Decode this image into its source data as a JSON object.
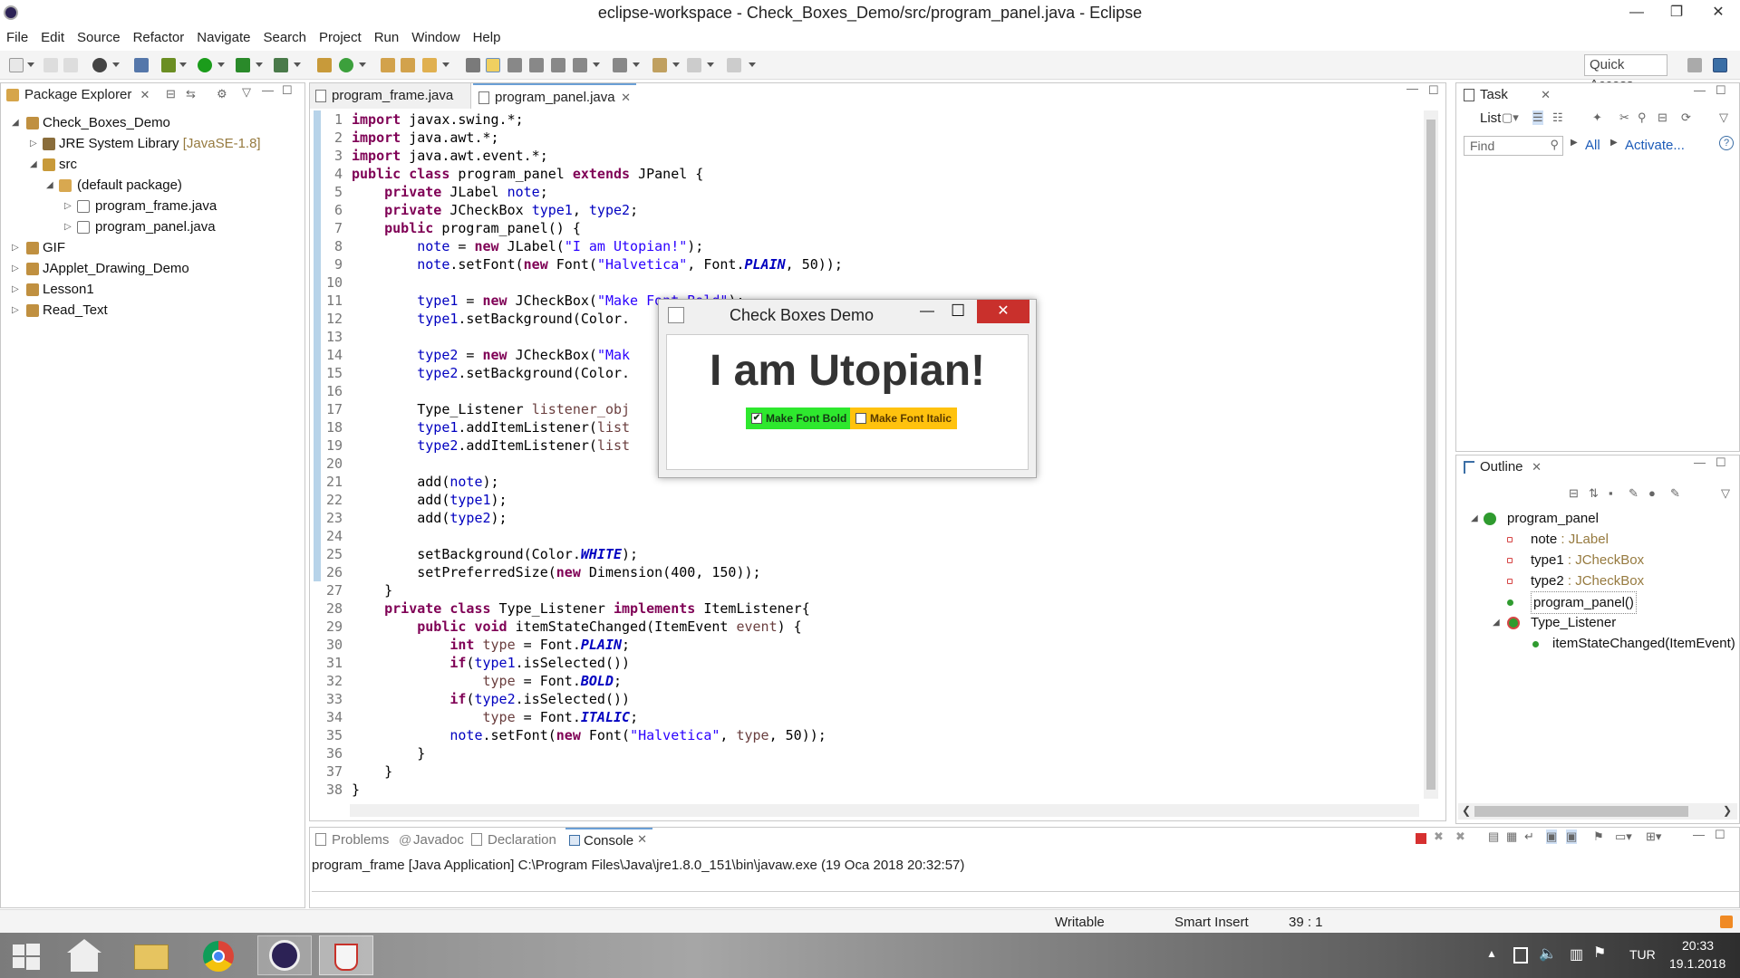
{
  "window": {
    "title": "eclipse-workspace - Check_Boxes_Demo/src/program_panel.java - Eclipse",
    "minimize": "—",
    "maximize": "❐",
    "close": "✕"
  },
  "menu": [
    "File",
    "Edit",
    "Source",
    "Refactor",
    "Navigate",
    "Search",
    "Project",
    "Run",
    "Window",
    "Help"
  ],
  "quick_access": "Quick Access",
  "package_explorer": {
    "title": "Package Explorer",
    "items": [
      {
        "label": "Check_Boxes_Demo",
        "depth": 0,
        "expanded": true
      },
      {
        "label": "JRE System Library",
        "decoration": "[JavaSE-1.8]",
        "depth": 1
      },
      {
        "label": "src",
        "depth": 1,
        "expanded": true
      },
      {
        "label": "(default package)",
        "depth": 2,
        "expanded": true
      },
      {
        "label": "program_frame.java",
        "depth": 3
      },
      {
        "label": "program_panel.java",
        "depth": 3
      },
      {
        "label": "GIF",
        "depth": 0
      },
      {
        "label": "JApplet_Drawing_Demo",
        "depth": 0
      },
      {
        "label": "Lesson1",
        "depth": 0
      },
      {
        "label": "Read_Text",
        "depth": 0
      }
    ]
  },
  "editor": {
    "tabs": [
      {
        "label": "program_frame.java",
        "active": false
      },
      {
        "label": "program_panel.java",
        "active": true
      }
    ],
    "lines": [
      "import javax.swing.*;",
      "import java.awt.*;",
      "import java.awt.event.*;",
      "public class program_panel extends JPanel {",
      "    private JLabel note;",
      "    private JCheckBox type1, type2;",
      "    public program_panel() {",
      "        note = new JLabel(\"I am Utopian!\");",
      "        note.setFont(new Font(\"Halvetica\", Font.PLAIN, 50));",
      "",
      "        type1 = new JCheckBox(\"Make Font Bold\");",
      "        type1.setBackground(Color.",
      "",
      "        type2 = new JCheckBox(\"Mak",
      "        type2.setBackground(Color.",
      "",
      "        Type_Listener listener_obj",
      "        type1.addItemListener(list",
      "        type2.addItemListener(list",
      "",
      "        add(note);",
      "        add(type1);",
      "        add(type2);",
      "",
      "        setBackground(Color.WHITE);",
      "        setPreferredSize(new Dimension(400, 150));",
      "    }",
      "    private class Type_Listener implements ItemListener{",
      "        public void itemStateChanged(ItemEvent event) {",
      "            int type = Font.PLAIN;",
      "            if(type1.isSelected())",
      "                type = Font.BOLD;",
      "            if(type2.isSelected())",
      "                type = Font.ITALIC;",
      "            note.setFont(new Font(\"Halvetica\", type, 50));",
      "        }",
      "    }",
      "}"
    ]
  },
  "dialog": {
    "title": "Check Boxes Demo",
    "label": "I am Utopian!",
    "checkbox1": {
      "label": "Make Font Bold",
      "checked": true,
      "color": "#2ee82e"
    },
    "checkbox2": {
      "label": "Make Font Italic",
      "checked": false,
      "color": "#ffc20e"
    },
    "min": "—",
    "max": "☐",
    "close": "✕"
  },
  "task_list": {
    "title": "Task List",
    "find_placeholder": "Find",
    "all": "All",
    "activate": "Activate..."
  },
  "outline": {
    "title": "Outline",
    "items": [
      {
        "label": "program_panel",
        "depth": 0
      },
      {
        "label": "note",
        "type": " : JLabel",
        "depth": 1
      },
      {
        "label": "type1",
        "type": " : JCheckBox",
        "depth": 1
      },
      {
        "label": "type2",
        "type": " : JCheckBox",
        "depth": 1
      },
      {
        "label": "program_panel()",
        "depth": 1
      },
      {
        "label": "Type_Listener",
        "depth": 1
      },
      {
        "label": "itemStateChanged(ItemEvent)",
        "depth": 2
      }
    ]
  },
  "bottom": {
    "tabs": [
      "Problems",
      "Javadoc",
      "Declaration",
      "Console"
    ],
    "active_tab": "Console",
    "console_text": "program_frame [Java Application] C:\\Program Files\\Java\\jre1.8.0_151\\bin\\javaw.exe (19 Oca 2018 20:32:57)"
  },
  "status": {
    "writable": "Writable",
    "insert_mode": "Smart Insert",
    "position": "39 : 1"
  },
  "taskbar": {
    "lang": "TUR",
    "time": "20:33",
    "date": "19.1.2018"
  }
}
